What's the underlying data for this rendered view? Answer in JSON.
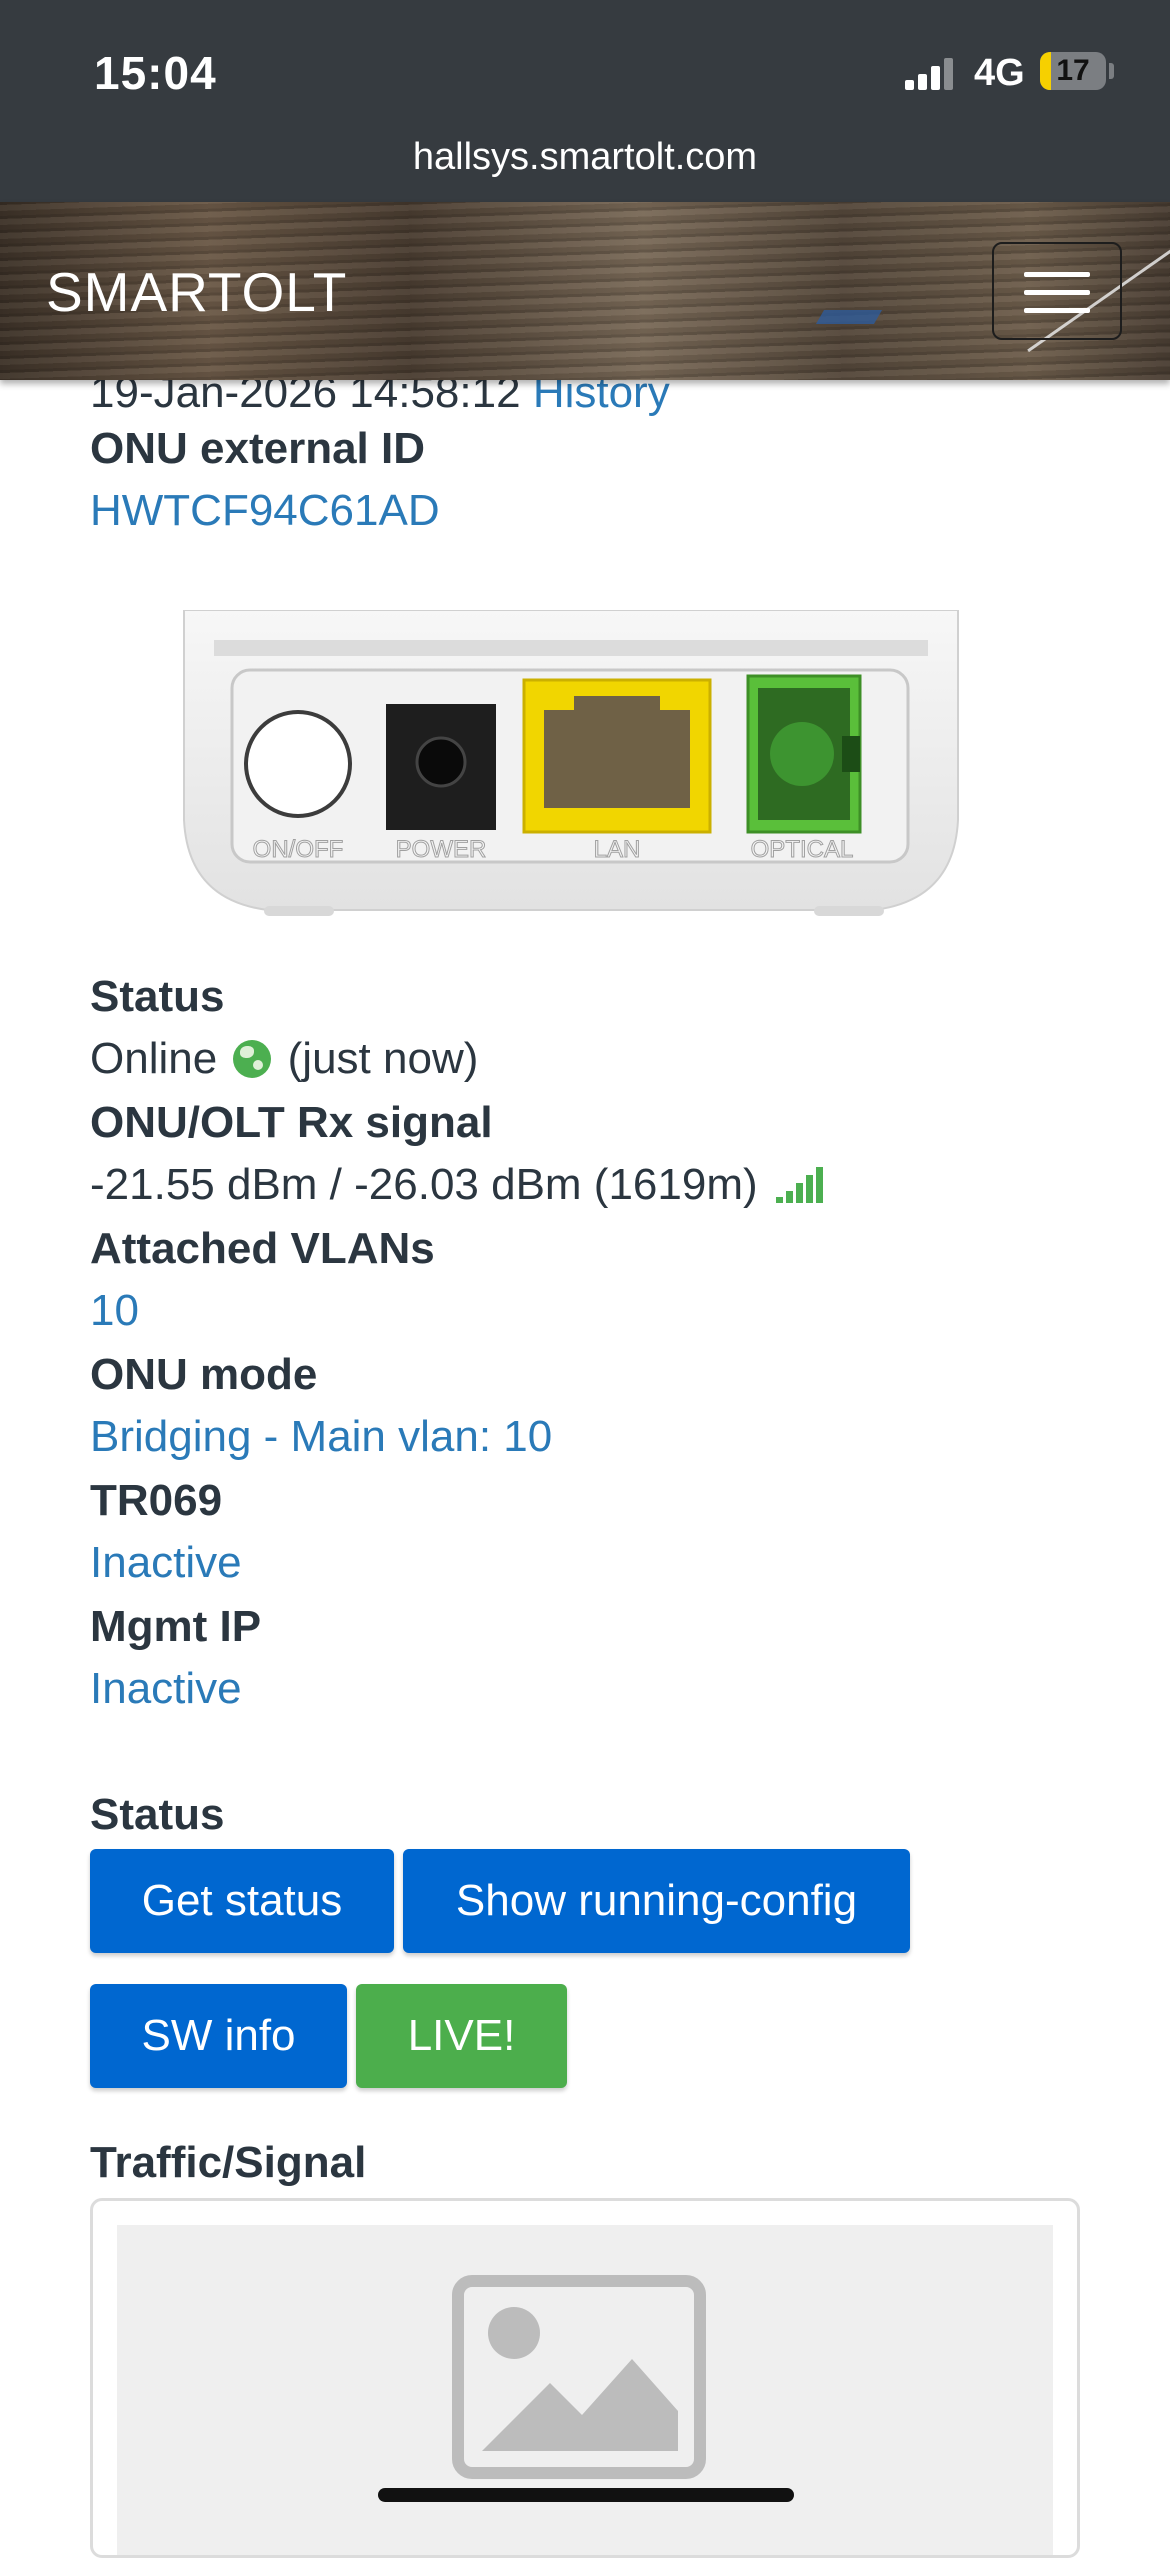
{
  "status_bar": {
    "time": "15:04",
    "network": "4G",
    "battery": "17",
    "battery_fraction": 0.17,
    "url": "hallsys.smartolt.com"
  },
  "navbar": {
    "brand": "SMARTOLT",
    "menu_icon": "hamburger-menu-icon"
  },
  "onu": {
    "last_seen_date": "19-Jan-2026 14:58:12",
    "history_link": "History",
    "external_id_label": "ONU external ID",
    "external_id": "HWTCF94C61AD",
    "port_labels": [
      "ON/OFF",
      "POWER",
      "LAN",
      "OPTICAL"
    ],
    "status_label": "Status",
    "status_value": "Online",
    "status_time": "(just now)",
    "rx_label": "ONU/OLT Rx signal",
    "rx_value": "-21.55 dBm / -26.03 dBm (1619m)",
    "vlans_label": "Attached VLANs",
    "vlans_value": "10",
    "mode_label": "ONU mode",
    "mode_value": "Bridging - Main vlan: 10",
    "tr069_label": "TR069",
    "tr069_value": "Inactive",
    "mgmt_label": "Mgmt IP",
    "mgmt_value": "Inactive"
  },
  "actions": {
    "section_label": "Status",
    "get_status": "Get status",
    "show_running_config": "Show running-config",
    "sw_info": "SW info",
    "live": "LIVE!"
  },
  "traffic": {
    "label": "Traffic/Signal",
    "placeholder_icon": "image-placeholder-icon"
  },
  "colors": {
    "link": "#2a7ab8",
    "button_blue": "#0067d0",
    "button_green": "#4cae4c",
    "status_green": "#4caf50"
  }
}
